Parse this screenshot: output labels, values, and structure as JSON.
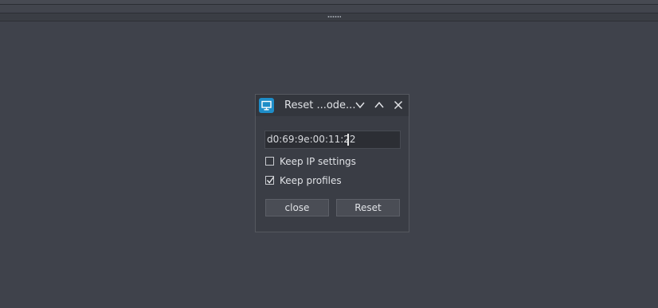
{
  "dialog": {
    "title": "Reset ...ode...",
    "app_icon": "monitor-icon",
    "titlebar_buttons": [
      "chevron-down-icon",
      "chevron-up-icon",
      "close-icon"
    ],
    "mac_value": "d0:69:9e:00:11:22",
    "keep_ip": {
      "label": "Keep IP settings",
      "checked": false
    },
    "keep_profiles": {
      "label": "Keep profiles",
      "checked": true
    },
    "close_label": "close",
    "reset_label": "Reset"
  },
  "colors": {
    "background": "#3f424b",
    "dialog": "#3a3d45",
    "accent": "#1e8dc8"
  }
}
